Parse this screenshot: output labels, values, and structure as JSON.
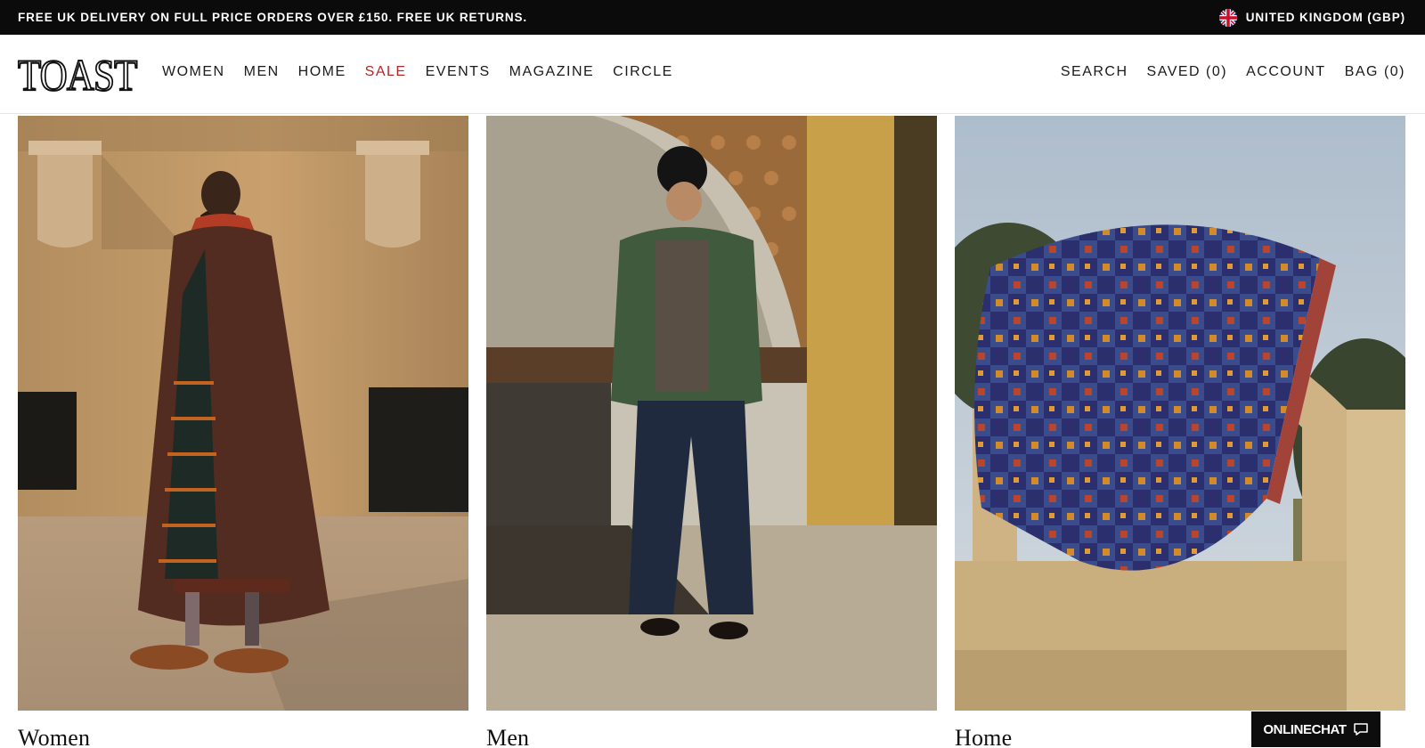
{
  "announcement": {
    "text": "FREE UK DELIVERY ON FULL PRICE ORDERS OVER £150. FREE UK RETURNS.",
    "region_label": "UNITED KINGDOM (GBP)",
    "region_icon": "uk-flag-icon"
  },
  "header": {
    "logo": "TOAST",
    "nav": [
      {
        "label": "WOMEN"
      },
      {
        "label": "MEN"
      },
      {
        "label": "HOME"
      },
      {
        "label": "SALE"
      },
      {
        "label": "EVENTS"
      },
      {
        "label": "MAGAZINE"
      },
      {
        "label": "CIRCLE"
      }
    ],
    "utility": {
      "search": "SEARCH",
      "saved": "SAVED (0)",
      "account": "ACCOUNT",
      "bag": "BAG (0)"
    }
  },
  "categories": [
    {
      "title": "Women"
    },
    {
      "title": "Men"
    },
    {
      "title": "Home"
    }
  ],
  "chat": {
    "label": "ONLINECHAT",
    "icon": "chat-bubble-icon"
  },
  "colors": {
    "announcement_bg": "#0b0b0b",
    "sale": "#b0262b",
    "text": "#1a1a1a"
  }
}
